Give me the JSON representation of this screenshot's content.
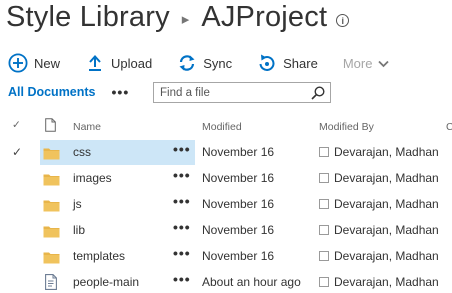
{
  "header": {
    "library_title": "Style Library",
    "separator": "▸",
    "folder_title": "AJProject",
    "info_glyph": "i"
  },
  "commands": {
    "new_label": "New",
    "upload_label": "Upload",
    "sync_label": "Sync",
    "share_label": "Share",
    "more_label": "More"
  },
  "view": {
    "current_view": "All Documents",
    "ellipsis": "•••",
    "search_placeholder": "Find a file"
  },
  "columns": {
    "name": "Name",
    "modified": "Modified",
    "modified_by": "Modified By",
    "overflow": "C"
  },
  "rows": [
    {
      "name": "css",
      "modified": "November 16",
      "modified_by": "Devarajan, Madhan",
      "type": "folder",
      "selected": true
    },
    {
      "name": "images",
      "modified": "November 16",
      "modified_by": "Devarajan, Madhan",
      "type": "folder",
      "selected": false
    },
    {
      "name": "js",
      "modified": "November 16",
      "modified_by": "Devarajan, Madhan",
      "type": "folder",
      "selected": false
    },
    {
      "name": "lib",
      "modified": "November 16",
      "modified_by": "Devarajan, Madhan",
      "type": "folder",
      "selected": false
    },
    {
      "name": "templates",
      "modified": "November 16",
      "modified_by": "Devarajan, Madhan",
      "type": "folder",
      "selected": false
    },
    {
      "name": "people-main",
      "modified": "About an hour ago",
      "modified_by": "Devarajan, Madhan",
      "type": "file",
      "selected": false
    }
  ],
  "row_ellipsis": "•••",
  "check_glyph": "✓",
  "colors": {
    "accent": "#0072c6",
    "folder": "#e8b54a",
    "selection": "#cde6f7"
  }
}
